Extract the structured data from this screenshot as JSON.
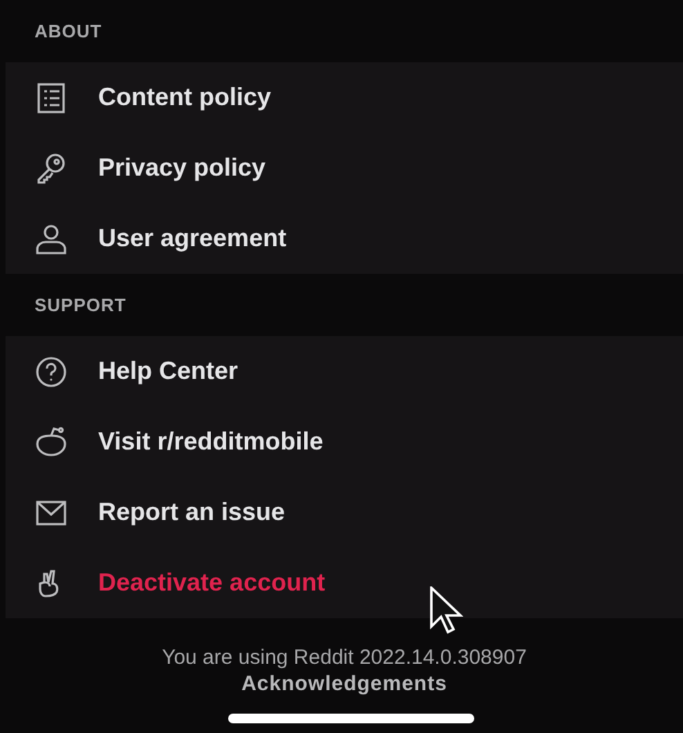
{
  "sections": [
    {
      "title": "ABOUT",
      "items": [
        {
          "label": "Content policy",
          "kind": "normal"
        },
        {
          "label": "Privacy policy",
          "kind": "normal"
        },
        {
          "label": "User agreement",
          "kind": "normal"
        }
      ]
    },
    {
      "title": "SUPPORT",
      "items": [
        {
          "label": "Help Center",
          "kind": "normal"
        },
        {
          "label": "Visit r/redditmobile",
          "kind": "normal"
        },
        {
          "label": "Report an issue",
          "kind": "normal"
        },
        {
          "label": "Deactivate account",
          "kind": "danger"
        }
      ]
    }
  ],
  "footer": {
    "version": "You are using Reddit 2022.14.0.308907",
    "link": "Acknowledgements"
  }
}
